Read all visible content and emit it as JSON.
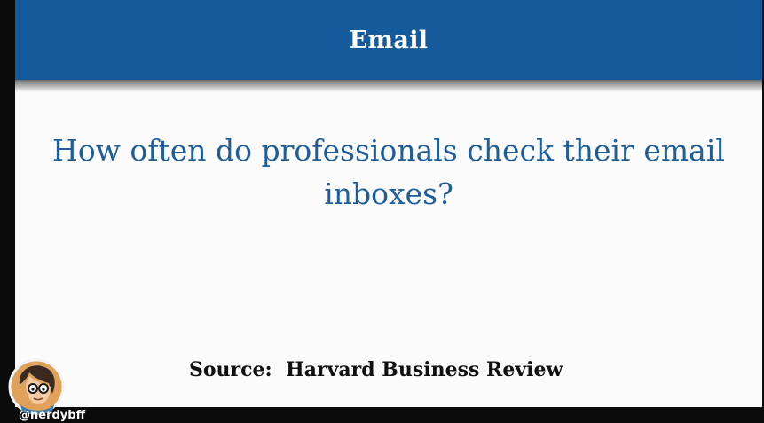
{
  "slide": {
    "title": "Email",
    "question": "How often do professionals check their email inboxes?",
    "source": "Source:  Harvard Business Review"
  },
  "watermark": {
    "handle": "@nerdybff",
    "avatar_icon": "cartoon-avatar-icon"
  },
  "colors": {
    "header": "#155a9a",
    "question_text": "#1e5e9b",
    "slide_background": "#fbfbfb",
    "frame": "#0b0b0b"
  }
}
